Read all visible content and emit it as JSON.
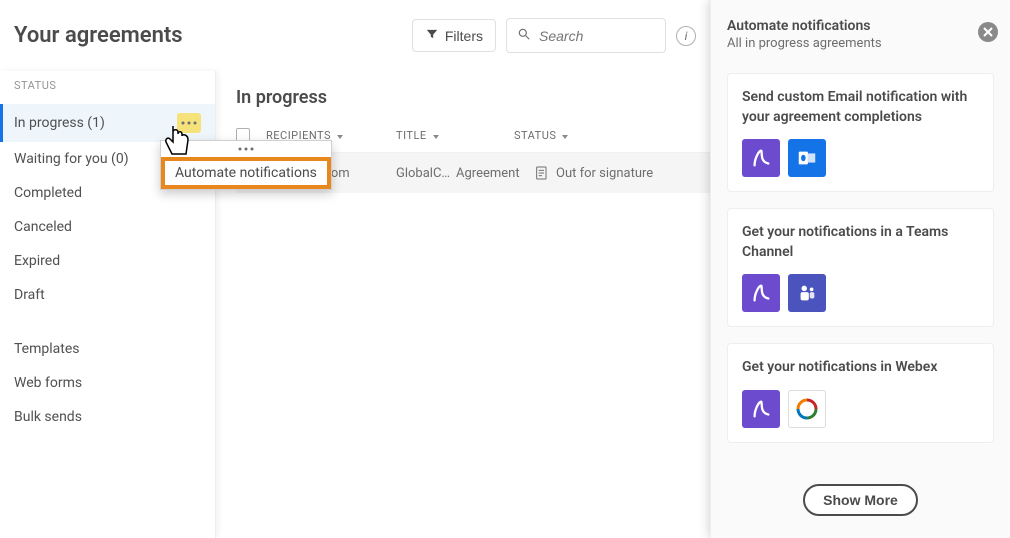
{
  "header": {
    "title": "Your agreements",
    "filters_label": "Filters",
    "search_placeholder": "Search"
  },
  "sidebar": {
    "heading": "STATUS",
    "items": [
      {
        "label": "In progress (1)",
        "active": true,
        "has_more": true
      },
      {
        "label": "Waiting for you (0)"
      },
      {
        "label": "Completed"
      },
      {
        "label": "Canceled"
      },
      {
        "label": "Expired"
      },
      {
        "label": "Draft"
      }
    ],
    "secondary": [
      {
        "label": "Templates"
      },
      {
        "label": "Web forms"
      },
      {
        "label": "Bulk sends"
      }
    ]
  },
  "popup": {
    "item": "Automate notifications"
  },
  "main": {
    "section_title": "In progress",
    "columns": {
      "recipients": "RECIPIENTS",
      "title": "TITLE",
      "status": "STATUS"
    },
    "row": {
      "email": "e@jupiter.dom",
      "title_short": "GlobalC…",
      "agreement": "Agreement",
      "status": "Out for signature"
    }
  },
  "panel": {
    "title": "Automate notifications",
    "subtitle": "All in progress agreements",
    "cards": [
      {
        "title": "Send custom Email notification with your agreement completions"
      },
      {
        "title": "Get your notifications in a Teams Channel"
      },
      {
        "title": "Get your notifications in Webex"
      }
    ],
    "show_more": "Show More"
  }
}
